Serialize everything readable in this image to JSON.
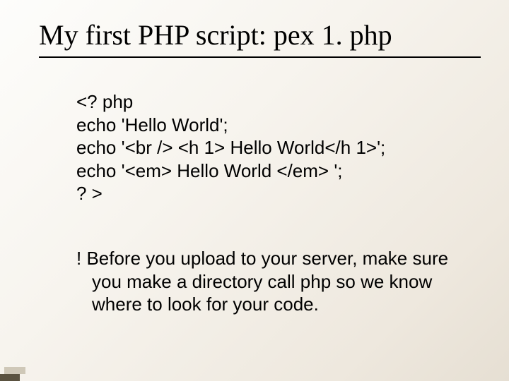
{
  "title": "My first PHP script: pex 1. php",
  "code": {
    "l1": "<? php",
    "l2": "echo 'Hello World';",
    "l3": "echo '<br /> <h 1> Hello World</h 1>';",
    "l4": "echo '<em> Hello World </em> ';",
    "l5": "? >"
  },
  "note": "! Before you upload to your server, make sure you make a directory call php so we know where to look for your code."
}
